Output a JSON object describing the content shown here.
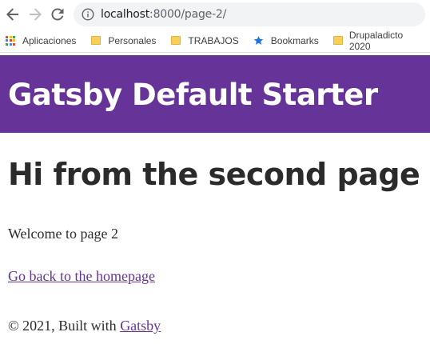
{
  "browser": {
    "url_host": "localhost",
    "url_path": ":8000/page-2/"
  },
  "bookmarks": [
    {
      "label": "Aplicaciones",
      "icon": "apps-grid-icon"
    },
    {
      "label": "Personales",
      "icon": "folder-icon"
    },
    {
      "label": "TRABAJOS",
      "icon": "folder-icon"
    },
    {
      "label": "Bookmarks",
      "icon": "star-icon"
    },
    {
      "label": "Drupaladicto 2020",
      "icon": "folder-icon"
    }
  ],
  "colors": {
    "header_bg": "#663399",
    "link": "#663399"
  },
  "site": {
    "title": "Gatsby Default Starter"
  },
  "page": {
    "heading": "Hi from the second page",
    "welcome": "Welcome to page 2",
    "back_link": "Go back to the homepage"
  },
  "footer": {
    "prefix": "© 2021, Built with ",
    "link": "Gatsby"
  }
}
